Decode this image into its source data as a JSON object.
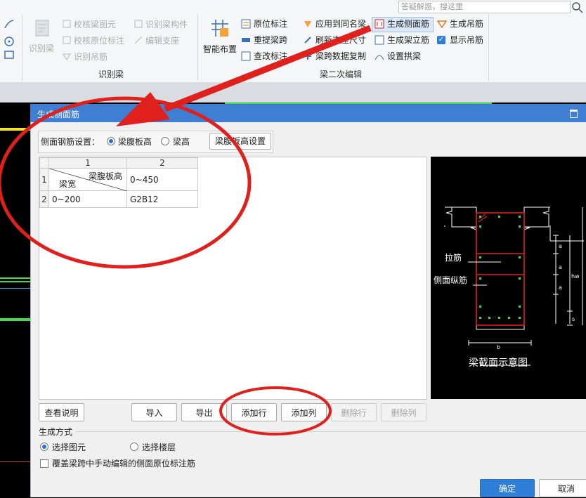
{
  "search": {
    "placeholder": "答疑解惑，搜这里"
  },
  "ribbon": {
    "identify_beam": "识别梁",
    "check_beam_element": "校核梁图元",
    "identify_beam_member": "识别梁构件",
    "check_inplace_label": "校核原位标注",
    "edit_support": "编辑支座",
    "identify_hanger": "识别吊筋",
    "group_identify_beam": "识别梁",
    "smart_layout": "智能布置",
    "inplace_label": "原位标注",
    "lift_span": "重提梁跨",
    "modify_label": "查改标注",
    "apply_same_beam": "应用到同名梁",
    "refresh_support": "刷新支座尺寸",
    "span_copy": "梁跨数据复制",
    "gen_side_rebar": "生成侧面筋",
    "gen_erect_rebar": "生成架立筋",
    "set_arch_beam": "设置拱梁",
    "gen_hanger": "生成吊筋",
    "show_hanger": "显示吊筋",
    "group_secondary_edit": "梁二次编辑"
  },
  "dialog": {
    "title": "生成侧面筋",
    "side_setting_label": "侧面钢筋设置：",
    "radio_web_height": "梁腹板高",
    "radio_beam_height": "梁高",
    "web_height_setting_btn": "梁腹板高设置",
    "table": {
      "col_headers": [
        "1",
        "2"
      ],
      "row_headers": [
        "1",
        "2"
      ],
      "corner_top": "梁腹板高",
      "corner_bottom": "梁宽",
      "rows": [
        [
          "",
          "0~450"
        ],
        [
          "0~200",
          "G2B12"
        ]
      ]
    },
    "diagram": {
      "tie_bar": "拉筋",
      "side_longitudinal": "侧面纵筋",
      "caption": "梁截面示意图",
      "dim_a": "a",
      "dim_hw": "hw",
      "dim_s": "s",
      "dim_b": "b"
    },
    "buttons": {
      "view_help": "查看说明",
      "import": "导入",
      "export": "导出",
      "add_row": "添加行",
      "add_col": "添加列",
      "del_row": "删除行",
      "del_col": "删除列",
      "ok": "确定",
      "cancel": "取消"
    },
    "gen_mode_label": "生成方式",
    "radio_select_element": "选择图元",
    "radio_select_floor": "选择楼层",
    "overwrite_checkbox": "覆盖梁跨中手动编辑的侧面原位标注筋"
  },
  "colors": {
    "annotation_red": "#e0201c",
    "dialog_title": "#3f7fd3",
    "ok_button": "#2f7fd9"
  }
}
